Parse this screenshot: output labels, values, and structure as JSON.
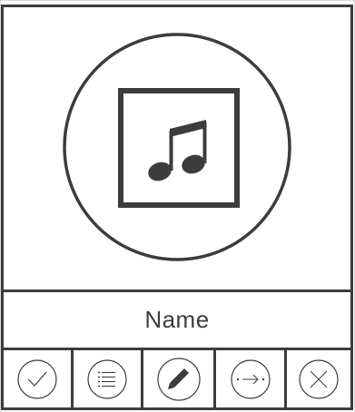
{
  "item": {
    "name": "Name",
    "thumbnail_icon": "music-note-icon"
  },
  "actions": [
    {
      "id": "confirm",
      "icon": "check-icon"
    },
    {
      "id": "list",
      "icon": "list-icon"
    },
    {
      "id": "edit",
      "icon": "pencil-icon"
    },
    {
      "id": "move",
      "icon": "arrow-right-icon"
    },
    {
      "id": "delete",
      "icon": "close-icon"
    }
  ],
  "colors": {
    "stroke": "#3c3c3c",
    "background": "#ffffff",
    "grid": "#d9d9d9"
  }
}
